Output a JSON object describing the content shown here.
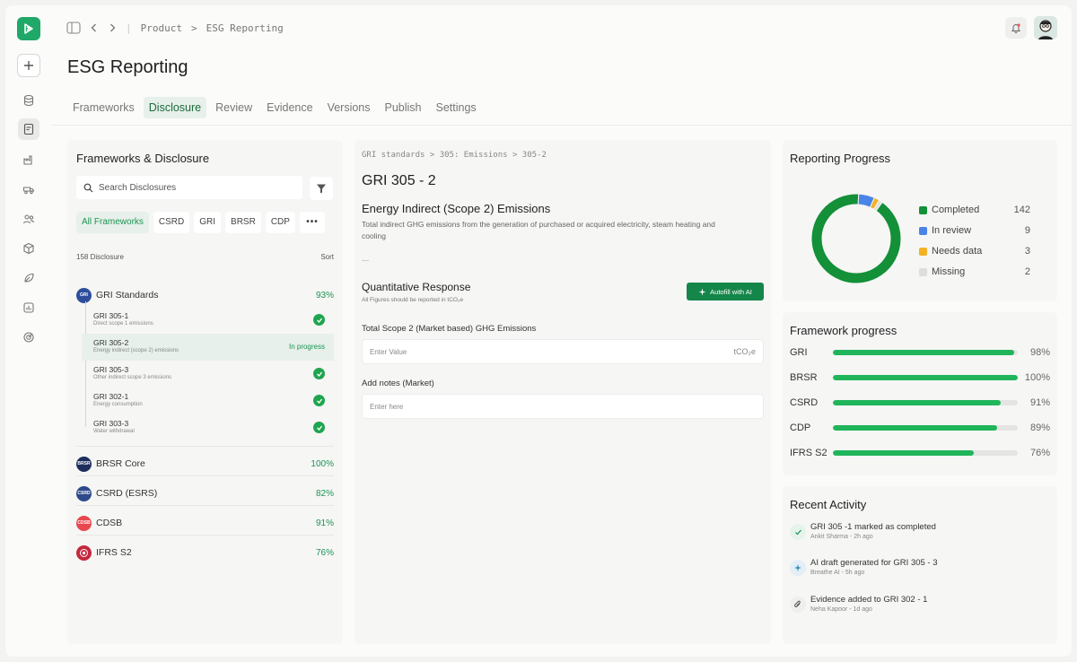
{
  "breadcrumb": {
    "root": "Product",
    "sep": ">",
    "current": "ESG Reporting"
  },
  "page_title": "ESG Reporting",
  "tabs": [
    "Frameworks",
    "Disclosure",
    "Review",
    "Evidence",
    "Versions",
    "Publish",
    "Settings"
  ],
  "active_tab": "Disclosure",
  "left": {
    "title": "Frameworks & Disclosure",
    "search_placeholder": "Search Disclosures",
    "chips": [
      "All Frameworks",
      "CSRD",
      "GRI",
      "BRSR",
      "CDP",
      "•••"
    ],
    "count": "158 Disclosure",
    "sort": "Sort",
    "gri": {
      "badge": "GRI",
      "name": "GRI Standards",
      "pct": "93%"
    },
    "sub_items": [
      {
        "code": "GRI 305-1",
        "desc": "Direct scope 1 emissions"
      },
      {
        "code": "GRI 305-2",
        "desc": "Energy indirect (scope 2) emissions",
        "status": "In progress"
      },
      {
        "code": "GRI 305-3",
        "desc": "Other indirect scope 3 emissions"
      },
      {
        "code": "GRI 302-1",
        "desc": "Energy consumption"
      },
      {
        "code": "GRI 303-3",
        "desc": "Water withdrawal"
      }
    ],
    "frameworks": [
      {
        "badge": "BRSR",
        "name": "BRSR Core",
        "pct": "100%",
        "color": "#1d2e5c"
      },
      {
        "badge": "CSRD",
        "name": "CSRD (ESRS)",
        "pct": "82%",
        "color": "#2d4a8a"
      },
      {
        "badge": "CDSB",
        "name": "CDSB",
        "pct": "91%",
        "color": "#e8474e"
      },
      {
        "badge": "",
        "name": "IFRS S2",
        "pct": "76%",
        "color": "#c5283d"
      }
    ]
  },
  "middle": {
    "crumb": "GRI standards  >  305: Emissions  >  305-2",
    "code": "GRI 305 - 2",
    "heading": "Energy Indirect (Scope 2) Emissions",
    "description": "Total indirect GHG emissions from the generation of purchased or acquired electricity, steam heating and cooling",
    "quant_title": "Quantitative Response",
    "quant_note": "All Figures should be reported in tCO₂e",
    "ai_button": "Autofill with AI",
    "field1_label": "Total Scope 2 (Market based) GHG Emissions",
    "field1_placeholder": "Enter Value",
    "field1_unit": "tCO₂e",
    "field2_label": "Add notes (Market)",
    "field2_placeholder": "Enter here"
  },
  "progress": {
    "title": "Reporting Progress",
    "legend": [
      {
        "label": "Completed",
        "value": "142",
        "color": "#139038"
      },
      {
        "label": "In review",
        "value": "9",
        "color": "#4a84e6"
      },
      {
        "label": "Needs data",
        "value": "3",
        "color": "#f2b222"
      },
      {
        "label": "Missing",
        "value": "2",
        "color": "#dddddb"
      }
    ]
  },
  "framework_progress": {
    "title": "Framework progress",
    "rows": [
      {
        "name": "GRI",
        "pct": "98%",
        "value": 98
      },
      {
        "name": "BRSR",
        "pct": "100%",
        "value": 100
      },
      {
        "name": "CSRD",
        "pct": "91%",
        "value": 91
      },
      {
        "name": "CDP",
        "pct": "89%",
        "value": 89
      },
      {
        "name": "IFRS S2",
        "pct": "76%",
        "value": 76
      }
    ]
  },
  "activity": {
    "title": "Recent Activity",
    "items": [
      {
        "text": "GRI 305 -1 marked as completed",
        "meta": "Ankit Sharma - 2h ago",
        "icon": "check-icon"
      },
      {
        "text": "AI draft generated for GRI 305 - 3",
        "meta": "Breathe AI - 5h ago",
        "icon": "sparkle-icon"
      },
      {
        "text": "Evidence added to GRI 302 - 1",
        "meta": "Neha Kapoor - 1d ago",
        "icon": "paperclip-icon"
      }
    ]
  }
}
